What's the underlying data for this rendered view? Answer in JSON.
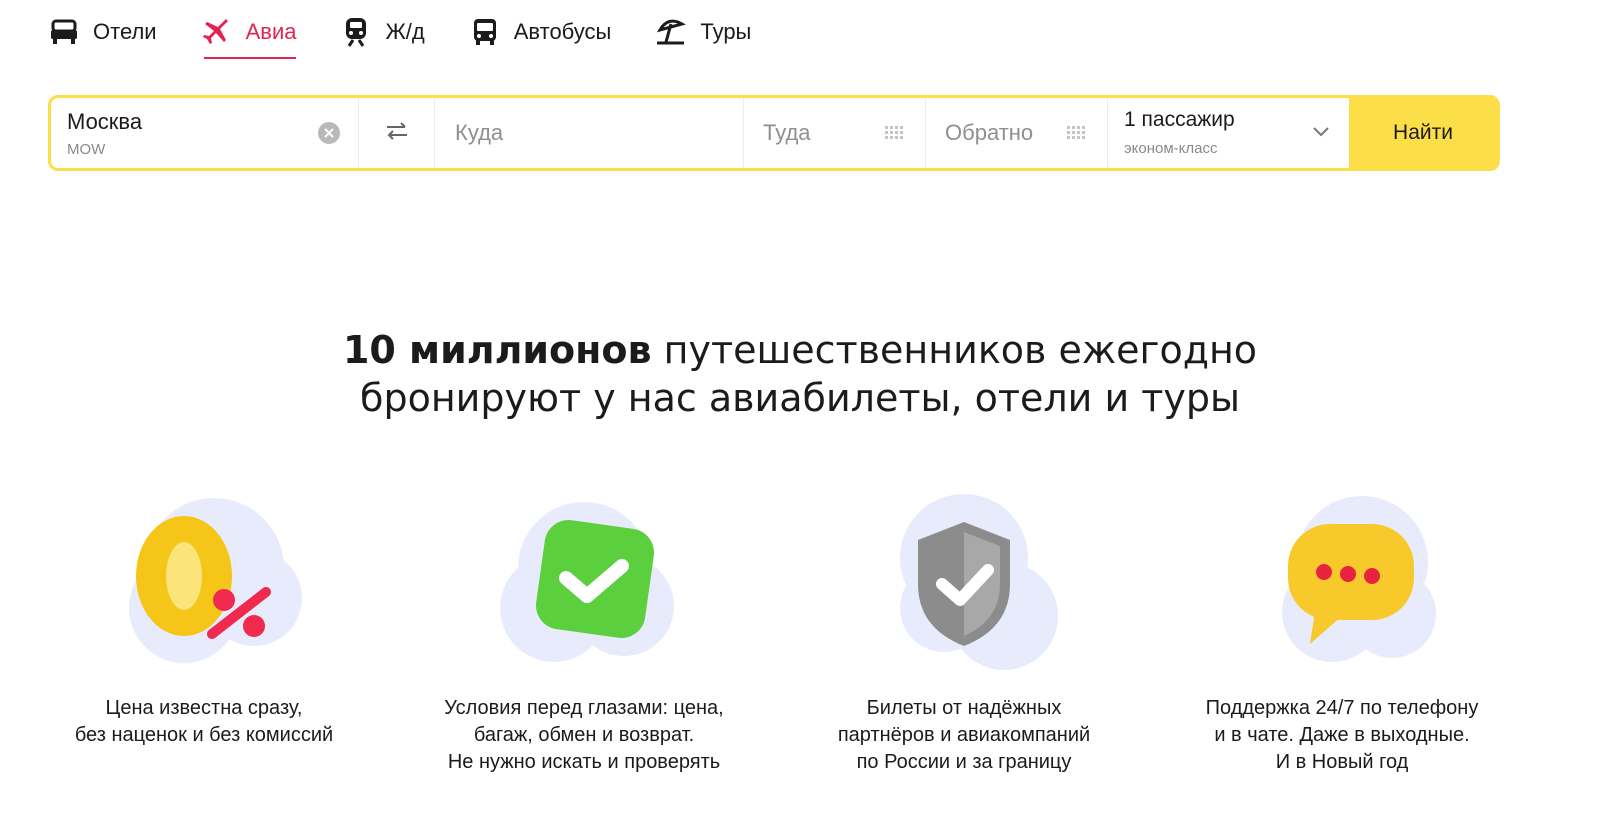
{
  "nav": {
    "items": [
      {
        "label": "Отели",
        "icon": "bed-icon"
      },
      {
        "label": "Авиа",
        "icon": "plane-icon",
        "active": true
      },
      {
        "label": "Ж/д",
        "icon": "train-icon"
      },
      {
        "label": "Автобусы",
        "icon": "bus-icon"
      },
      {
        "label": "Туры",
        "icon": "beach-umbrella-icon"
      }
    ],
    "active_color": "#e32450"
  },
  "search": {
    "from_value": "Москва",
    "from_code": "MOW",
    "to_placeholder": "Куда",
    "depart_placeholder": "Туда",
    "return_placeholder": "Обратно",
    "passengers": "1 пассажир",
    "cabin_class": "эконом-класс",
    "find_label": "Найти",
    "accent_color": "#fcdf48"
  },
  "headline": {
    "bold": "10 миллионов",
    "line1_rest": " путешественников ежегодно",
    "line2": "бронируют у нас авиабилеты, отели и туры"
  },
  "features": [
    {
      "icon": "zero-percent-icon",
      "lines": [
        "Цена известна сразу,",
        "без наценок и без комиссий"
      ]
    },
    {
      "icon": "green-check-icon",
      "lines": [
        "Условия перед глазами: цена,",
        "багаж, обмен и возврат.",
        "Не нужно искать и проверять"
      ]
    },
    {
      "icon": "shield-check-icon",
      "lines": [
        "Билеты от надёжных",
        "партнёров и авиакомпаний",
        "по России и за границу"
      ]
    },
    {
      "icon": "chat-bubble-icon",
      "lines": [
        "Поддержка 24/7 по телефону",
        "и в чате. Даже в выходные.",
        "И в Новый год"
      ]
    }
  ]
}
